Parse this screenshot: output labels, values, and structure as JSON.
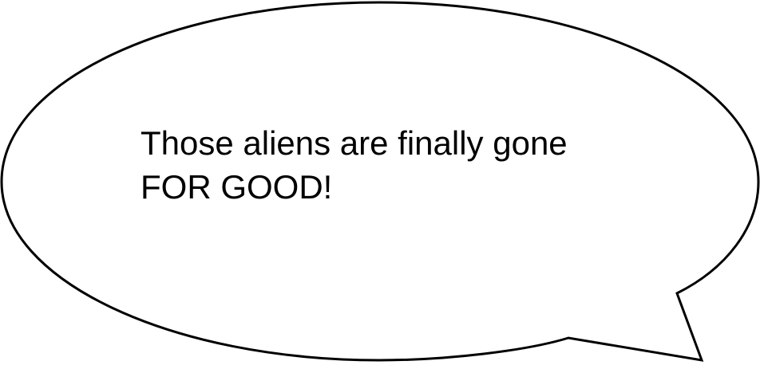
{
  "speech_bubble": {
    "lines": [
      "Those aliens are finally gone",
      "FOR GOOD!"
    ],
    "fill_color": "#ffffff",
    "stroke_color": "#000000",
    "text_color": "#000000"
  }
}
